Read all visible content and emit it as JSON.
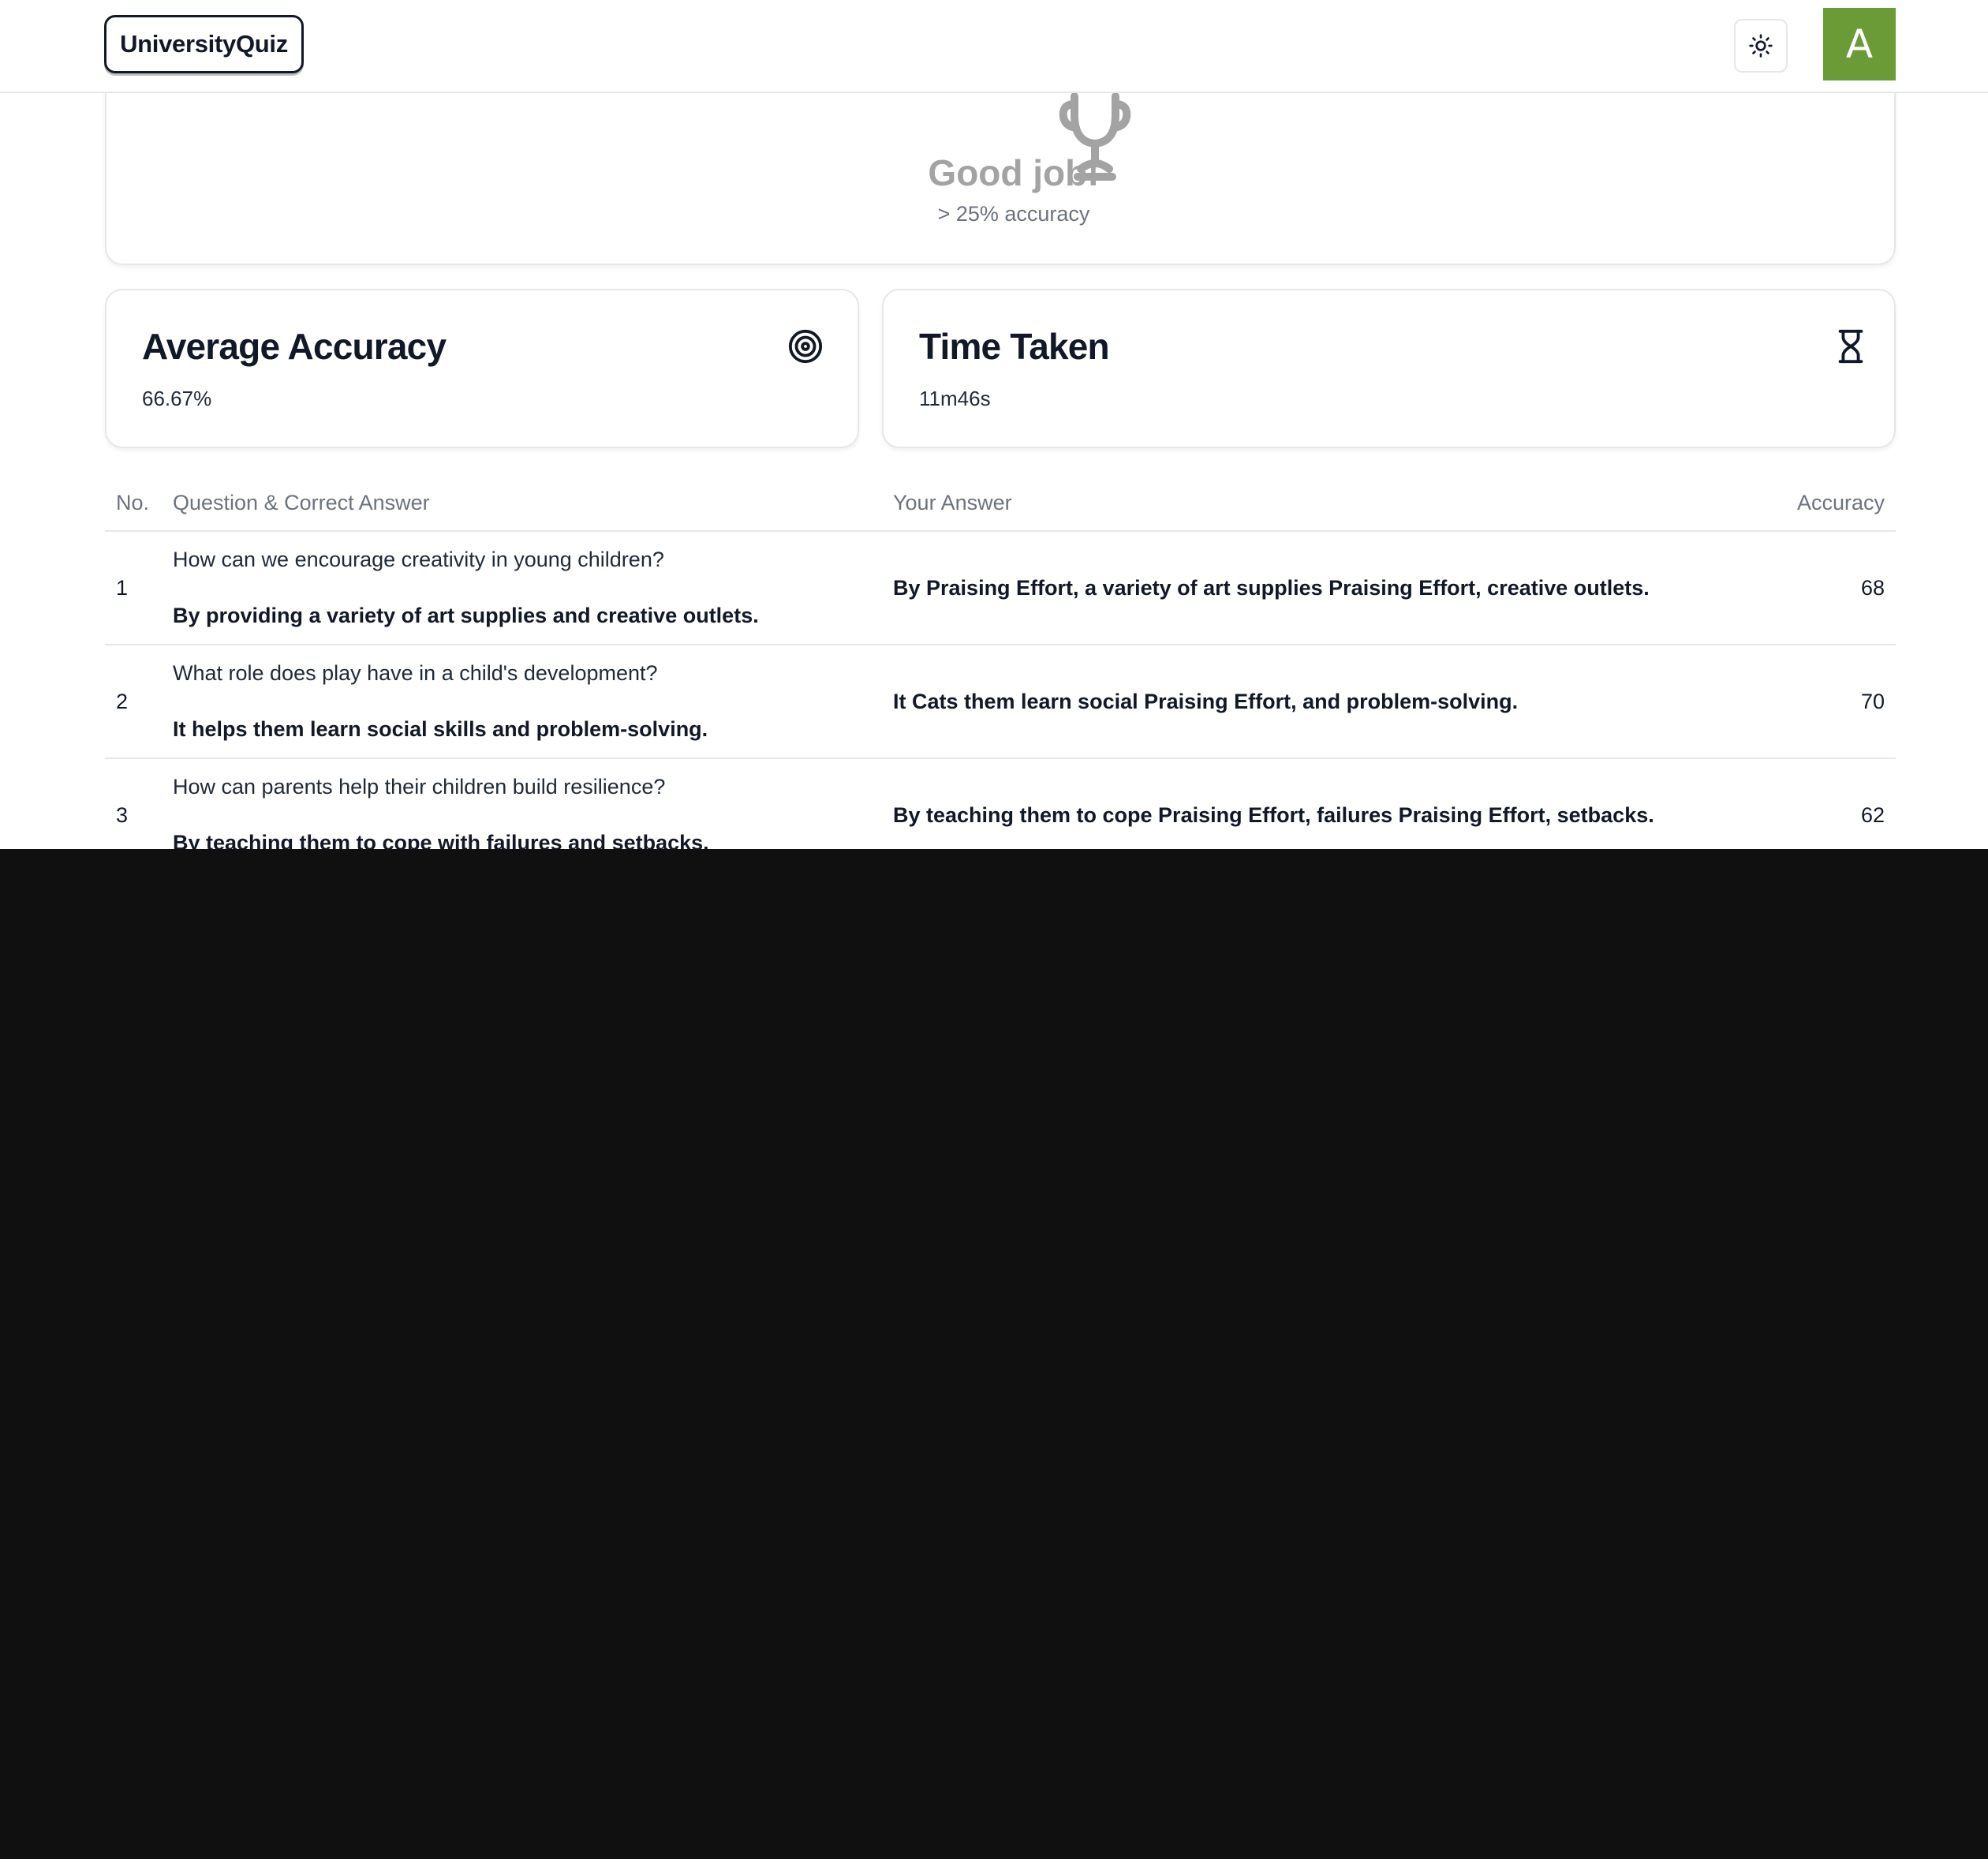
{
  "navbar": {
    "brand": "UniversityQuiz",
    "theme_icon": "sun-icon",
    "avatar_initial": "A",
    "avatar_color": "#6b9b37"
  },
  "result_banner": {
    "icon": "trophy-icon",
    "title": "Good job!",
    "subtitle": "> 25% accuracy"
  },
  "stats": {
    "accuracy": {
      "title": "Average Accuracy",
      "value": "66.67%",
      "icon": "target-icon"
    },
    "time": {
      "title": "Time Taken",
      "value": "11m46s",
      "icon": "hourglass-icon"
    }
  },
  "table": {
    "headers": {
      "no": "No.",
      "question": "Question & Correct Answer",
      "your_answer": "Your Answer",
      "accuracy": "Accuracy"
    },
    "rows": [
      {
        "no": "1",
        "question": "How can we encourage creativity in young children?",
        "correct_answer": "By providing a variety of art supplies and creative outlets.",
        "your_answer": "By Praising Effort, a variety of art supplies Praising Effort, creative outlets.",
        "accuracy": "68"
      },
      {
        "no": "2",
        "question": "What role does play have in a child's development?",
        "correct_answer": "It helps them learn social skills and problem-solving.",
        "your_answer": "It Cats them learn social Praising Effort, and problem-solving.",
        "accuracy": "70"
      },
      {
        "no": "3",
        "question": "How can parents help their children build resilience?",
        "correct_answer": "By teaching them to cope with failures and setbacks.",
        "your_answer": "By teaching them to cope Praising Effort, failures Praising Effort, setbacks.",
        "accuracy": "62"
      }
    ]
  }
}
